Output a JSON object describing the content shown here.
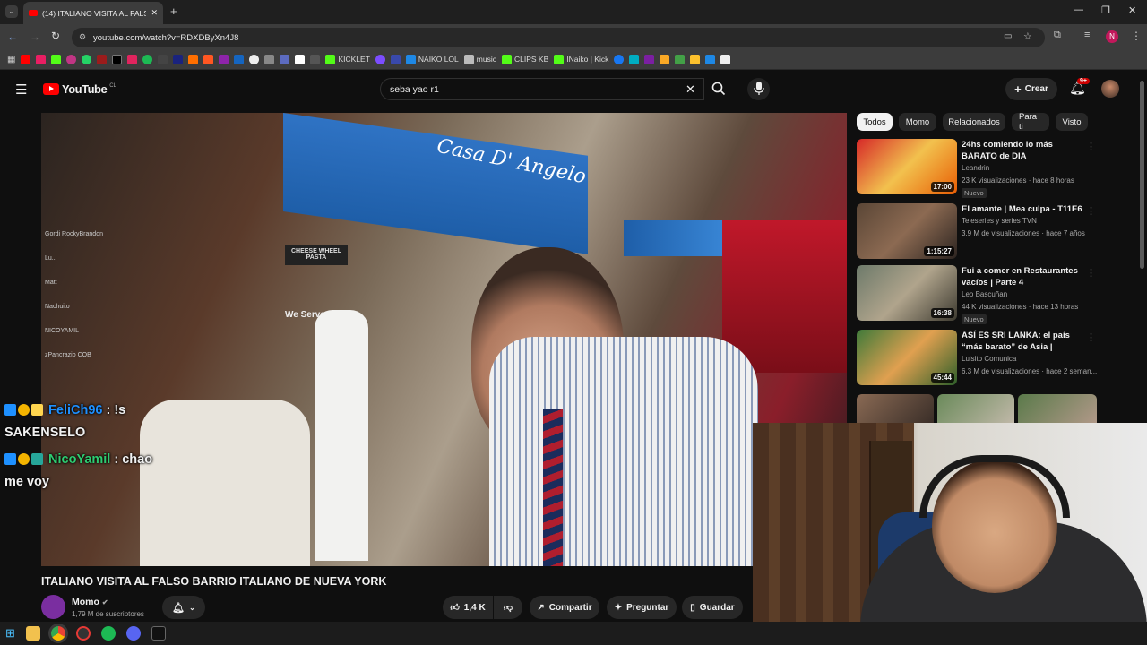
{
  "browser": {
    "tab_title": "(14) ITALIANO VISITA AL FALS",
    "url": "youtube.com/watch?v=RDXDByXn4J8",
    "bookmarks": [
      {
        "label": "KICKLET",
        "color": "#53fc18"
      },
      {
        "label": "NAIKO LOL",
        "color": "#1e88e5"
      },
      {
        "label": "music",
        "color": "#bbbbbb"
      },
      {
        "label": "CLIPS KB",
        "color": "#53fc18"
      },
      {
        "label": "INaiko | Kick",
        "color": "#53fc18"
      }
    ]
  },
  "youtube": {
    "logo_text": "YouTube",
    "region": "CL",
    "search_value": "seba yao r1",
    "create_label": "Crear",
    "notif_count": "9+",
    "chips": [
      "Todos",
      "Momo",
      "Relacionados",
      "Para ti",
      "Visto"
    ]
  },
  "video": {
    "title": "ITALIANO VISITA AL FALSO BARRIO ITALIANO DE NUEVA YORK",
    "sign_text": "Casa D' Angelo",
    "sign2": "CHEESE WHEEL PASTA",
    "sign3": "We Serve",
    "channel": "Momo",
    "subscribers": "1,79 M de suscriptores",
    "likes": "1,4 K",
    "share_label": "Compartir",
    "ask_label": "Preguntar",
    "save_label": "Guardar"
  },
  "chat": [
    {
      "user": "FeliCh96",
      "user_color": "#1e90ff",
      "text": ": !s",
      "cont": "SAKENSELO"
    },
    {
      "user": "NicoYamil",
      "user_color": "#2ecc71",
      "text": ": chao",
      "cont": "me voy"
    }
  ],
  "discord_overlay": [
    "Gordi RockyBrandon",
    "Lu...",
    "Matt",
    "Nachuito",
    "NICOYAMIL",
    "zPancrazio COB"
  ],
  "related": [
    {
      "title": "24hs comiendo lo más BARATO de DIA",
      "channel": "Leandrin",
      "meta": "23 K visualizaciones · hace 8 horas",
      "new": "Nuevo",
      "duration": "17:00",
      "thumb": "linear-gradient(135deg,#d62828,#f2c14e 50%,#e85d04)"
    },
    {
      "title": "El amante | Mea culpa - T11E6",
      "channel": "Teleseries y series TVN",
      "meta": "3,9 M de visualizaciones · hace 7 años",
      "new": "",
      "duration": "1:15:27",
      "thumb": "linear-gradient(135deg,#5a4636,#8c6a52 50%,#2c2420)"
    },
    {
      "title": "Fui a comer en Restaurantes vacíos | Parte 4",
      "channel": "Leo Bascuñan",
      "meta": "44 K visualizaciones · hace 13 horas",
      "new": "Nuevo",
      "duration": "16:38",
      "thumb": "linear-gradient(135deg,#6d7a6a,#b0a48c 50%,#3d3a30)"
    },
    {
      "title": "ASÍ ES SRI LANKA: el país “más barato” de Asia | ¿Cómo viven?...",
      "channel": "Luisito Comunica",
      "meta": "6,3 M de visualizaciones · hace 2 seman...",
      "new": "",
      "duration": "45:44",
      "thumb": "linear-gradient(135deg,#3f7a3a,#e0a050 50%,#2e5f2a)"
    }
  ]
}
